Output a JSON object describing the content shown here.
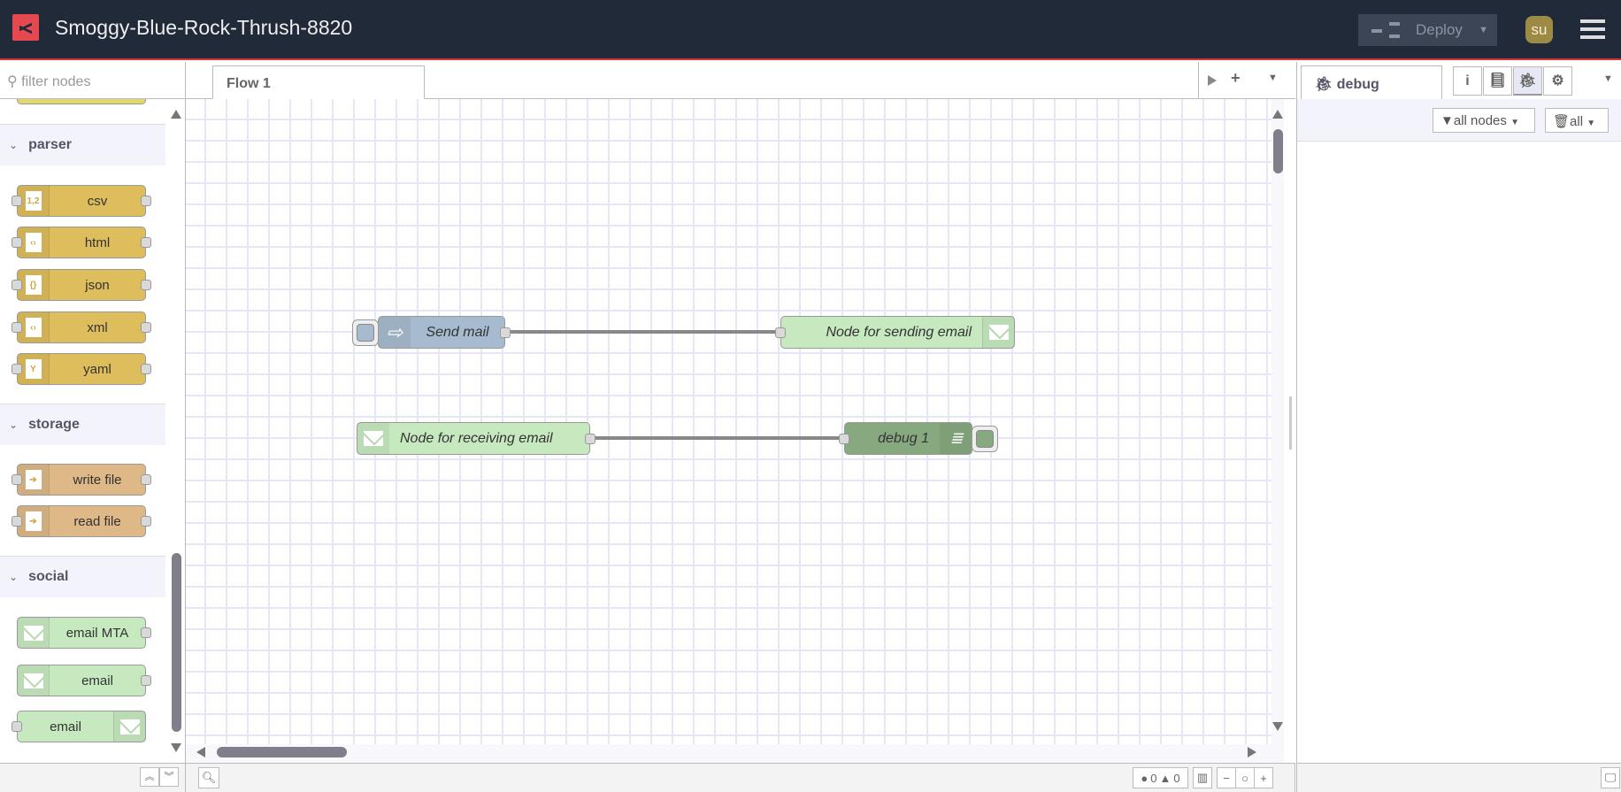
{
  "header": {
    "title": "Smoggy-Blue-Rock-Thrush-8820",
    "deploy_label": "Deploy",
    "user_initials": "su"
  },
  "palette": {
    "filter_placeholder": "filter nodes",
    "categories": [
      {
        "name": "parser",
        "nodes": [
          {
            "label": "csv",
            "icon": "1,2"
          },
          {
            "label": "html",
            "icon": "‹›"
          },
          {
            "label": "json",
            "icon": "{}"
          },
          {
            "label": "xml",
            "icon": "‹›"
          },
          {
            "label": "yaml",
            "icon": "Y"
          }
        ]
      },
      {
        "name": "storage",
        "nodes": [
          {
            "label": "write file"
          },
          {
            "label": "read file"
          }
        ]
      },
      {
        "name": "social",
        "nodes": [
          {
            "label": "email MTA"
          },
          {
            "label": "email"
          },
          {
            "label": "email"
          }
        ]
      }
    ],
    "colors": {
      "parser": "#debd5c",
      "storage": "#deb887",
      "social": "#c7e9c0"
    }
  },
  "workspace": {
    "tabs": [
      {
        "label": "Flow 1"
      }
    ],
    "nodes": [
      {
        "label": "Send mail",
        "type": "inject",
        "color": "#a6bbcf"
      },
      {
        "label": "Node for sending email",
        "type": "email-out",
        "color": "#c7e9c0"
      },
      {
        "label": "Node for receiving email",
        "type": "email-in",
        "color": "#c7e9c0"
      },
      {
        "label": "debug 1",
        "type": "debug",
        "color": "#87a980"
      }
    ],
    "footer": {
      "errors": "0",
      "warnings": "0"
    }
  },
  "sidebar": {
    "active_tab": "debug",
    "filter_label": "all nodes",
    "clear_label": "all"
  }
}
